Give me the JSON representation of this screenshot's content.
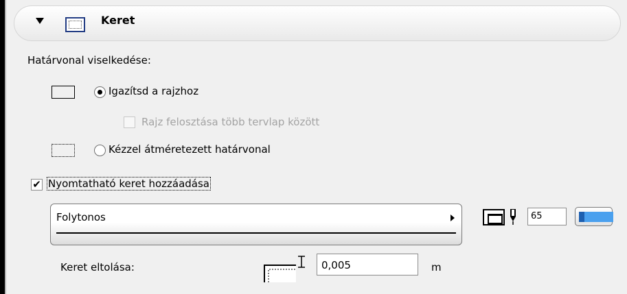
{
  "header": {
    "title": "Keret"
  },
  "border_behavior": {
    "label": "Határvonal viselkedése:",
    "option_fit": "Igazítsd a rajzhoz",
    "option_split": "Rajz felosztása több tervlap között",
    "option_manual": "Kézzel átméretezett határvonal"
  },
  "printable_frame": {
    "label": "Nyomtatható keret hozzáadása",
    "checked": true,
    "line_type": "Folytonos",
    "pen_number": "65"
  },
  "frame_offset": {
    "label": "Keret eltolása:",
    "value": "0,005",
    "unit": "m"
  },
  "colors": {
    "swatch": "#4aa0ee",
    "header_icon": "#233d84"
  }
}
